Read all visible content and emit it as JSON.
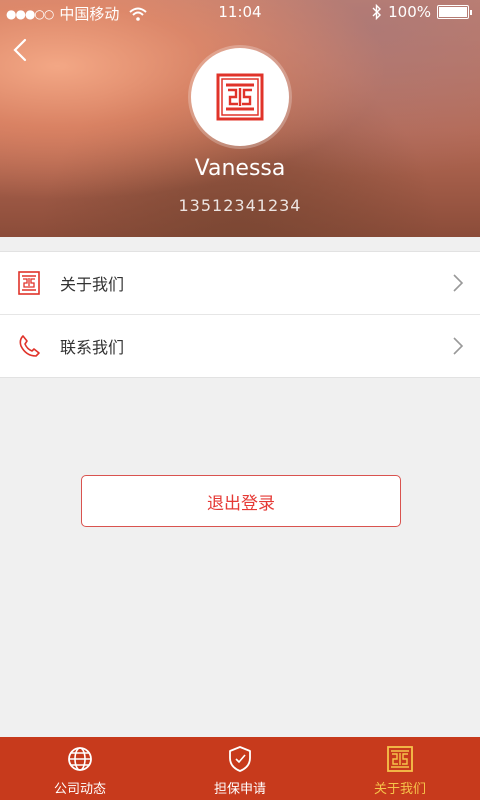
{
  "status_bar": {
    "signal_dots": "●●●○○",
    "carrier": "中国移动",
    "time": "11:04",
    "battery": "100%"
  },
  "profile": {
    "name": "Vanessa",
    "phone": "13512341234"
  },
  "menu": {
    "items": [
      {
        "label": "关于我们",
        "icon": "seal-logo-icon"
      },
      {
        "label": "联系我们",
        "icon": "phone-icon"
      }
    ]
  },
  "logout": {
    "label": "退出登录"
  },
  "tabbar": {
    "tabs": [
      {
        "label": "公司动态",
        "icon": "globe-icon",
        "active": false
      },
      {
        "label": "担保申请",
        "icon": "shield-icon",
        "active": false
      },
      {
        "label": "关于我们",
        "icon": "seal-logo-icon",
        "active": true
      }
    ]
  },
  "colors": {
    "accent_red": "#c73a1c",
    "active_tab": "#f6c34a",
    "logout_text": "#e53935"
  }
}
